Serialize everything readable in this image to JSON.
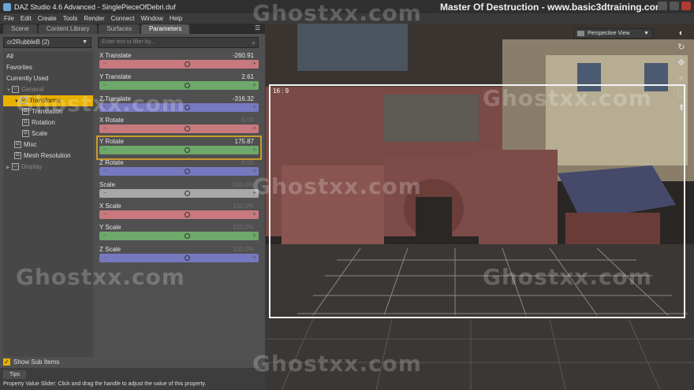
{
  "window": {
    "title": "DAZ Studio 4.6 Advanced - SinglePieceOfDebri.duf",
    "brand": "Master Of Destruction - www.basic3dtraining.com"
  },
  "menu": [
    "File",
    "Edit",
    "Create",
    "Tools",
    "Render",
    "Connect",
    "Window",
    "Help"
  ],
  "tabs": [
    {
      "label": "Scene",
      "active": false
    },
    {
      "label": "Content Library",
      "active": false
    },
    {
      "label": "Surfaces",
      "active": false
    },
    {
      "label": "Parameters",
      "active": true
    }
  ],
  "node_selector": {
    "value": "cr2RubbleB (2)"
  },
  "filter": {
    "placeholder": "Enter text to filter by..."
  },
  "tree": [
    {
      "label": "All",
      "indent": 0,
      "state": "normal"
    },
    {
      "label": "Favorites",
      "indent": 0,
      "state": "normal"
    },
    {
      "label": "Currently Used",
      "indent": 0,
      "state": "normal"
    },
    {
      "label": "General",
      "indent": 0,
      "state": "dim",
      "group": true,
      "expanded": true
    },
    {
      "label": "Transforms",
      "indent": 1,
      "state": "selected",
      "group": true,
      "expanded": true
    },
    {
      "label": "Translation",
      "indent": 2,
      "state": "normal",
      "group": true
    },
    {
      "label": "Rotation",
      "indent": 2,
      "state": "normal",
      "group": true
    },
    {
      "label": "Scale",
      "indent": 2,
      "state": "normal",
      "group": true
    },
    {
      "label": "Misc",
      "indent": 1,
      "state": "normal",
      "group": true
    },
    {
      "label": "Mesh Resolution",
      "indent": 1,
      "state": "normal",
      "group": true
    },
    {
      "label": "Display",
      "indent": 0,
      "state": "dim",
      "group": true,
      "expanded": false
    }
  ],
  "parameters": [
    {
      "name": "X Translate",
      "value": "-260.91",
      "color": "red",
      "knob": 0.55,
      "active": true
    },
    {
      "name": "Y Translate",
      "value": "2.61",
      "color": "green",
      "knob": 0.55,
      "active": true
    },
    {
      "name": "Z Translate",
      "value": "-316.32",
      "color": "blue",
      "knob": 0.55,
      "active": true
    },
    {
      "name": "X Rotate",
      "value": "0.00",
      "color": "red",
      "knob": 0.55,
      "active": false
    },
    {
      "name": "Y Rotate",
      "value": "175.87",
      "color": "green",
      "knob": 0.55,
      "active": true,
      "highlight": true
    },
    {
      "name": "Z Rotate",
      "value": "0.00",
      "color": "blue",
      "knob": 0.55,
      "active": false
    },
    {
      "name": "Scale",
      "value": "100.0%",
      "color": "gray",
      "knob": 0.55,
      "active": false
    },
    {
      "name": "X Scale",
      "value": "100.0%",
      "color": "red",
      "knob": 0.55,
      "active": false
    },
    {
      "name": "Y Scale",
      "value": "100.0%",
      "color": "green",
      "knob": 0.55,
      "active": false
    },
    {
      "name": "Z Scale",
      "value": "100.0%",
      "color": "blue",
      "knob": 0.55,
      "active": false
    }
  ],
  "show_sub_items": {
    "label": "Show Sub Items",
    "checked": true
  },
  "status": {
    "tab": "Tips",
    "tip": "Property Value Slider: Click and drag the handle to adjust the value of this property."
  },
  "viewport": {
    "camera": "Perspective View",
    "aspect_label": "16 : 9"
  },
  "watermark": "Ghostxx.com",
  "colors": {
    "red": "#c7797e",
    "green": "#6ea86a",
    "blue": "#7678c0",
    "gray": "#a8a8a8",
    "selection": "#e8b000"
  }
}
